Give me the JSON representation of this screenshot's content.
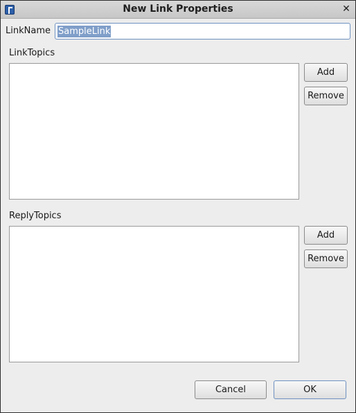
{
  "window": {
    "title": "New Link Properties"
  },
  "link_name": {
    "label": "LinkName",
    "value": "SampleLink"
  },
  "link_topics": {
    "label": "LinkTopics",
    "add_label": "Add",
    "remove_label": "Remove"
  },
  "reply_topics": {
    "label": "ReplyTopics",
    "add_label": "Add",
    "remove_label": "Remove"
  },
  "footer": {
    "cancel_label": "Cancel",
    "ok_label": "OK"
  },
  "icons": {
    "app": "app-icon",
    "close": "close-icon",
    "close_glyph": "✕"
  }
}
